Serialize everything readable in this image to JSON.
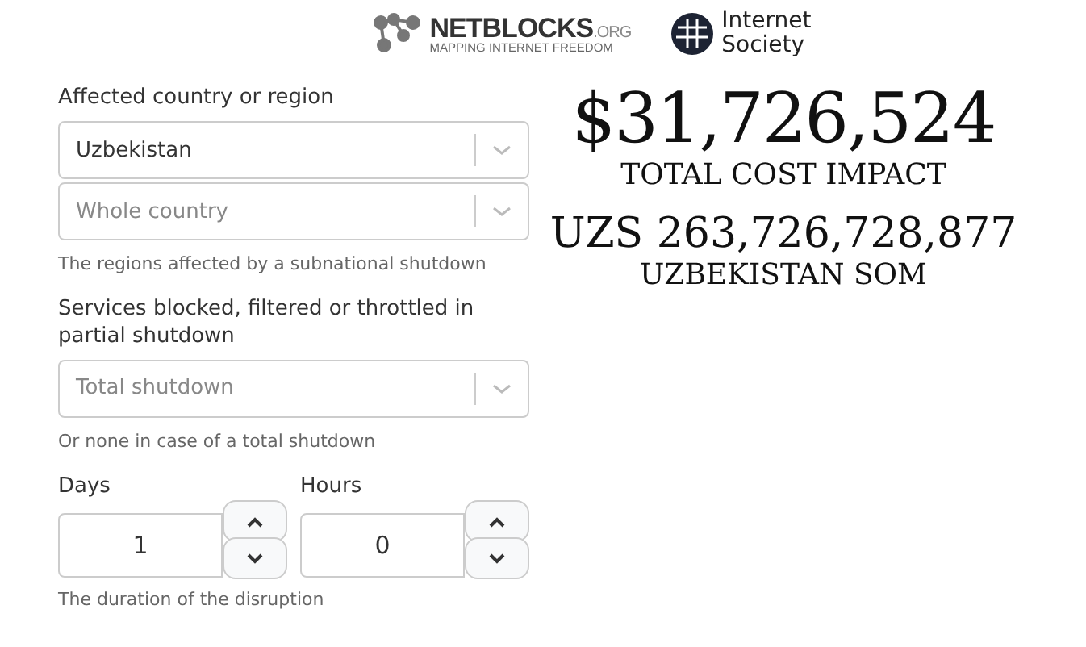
{
  "header": {
    "netblocks": {
      "name": "NETBLOCKS",
      "suffix": ".ORG",
      "tagline": "MAPPING INTERNET FREEDOM"
    },
    "isoc": {
      "line1": "Internet",
      "line2": "Society"
    }
  },
  "form": {
    "country": {
      "label": "Affected country or region",
      "selects": [
        {
          "value": "Uzbekistan"
        },
        {
          "placeholder": "Whole country"
        }
      ],
      "help": "The regions affected by a subnational shutdown"
    },
    "services": {
      "label": "Services blocked, filtered or throttled in partial shutdown",
      "select": {
        "placeholder": "Total shutdown"
      },
      "help": "Or none in case of a total shutdown"
    },
    "duration": {
      "fields": [
        {
          "label": "Days",
          "value": "1"
        },
        {
          "label": "Hours",
          "value": "0"
        }
      ],
      "help": "The duration of the disruption"
    }
  },
  "result": {
    "usd": "$31,726,524",
    "usd_label": "TOTAL COST IMPACT",
    "local": "UZS 263,726,728,877",
    "local_label": "UZBEKISTAN SOM"
  }
}
